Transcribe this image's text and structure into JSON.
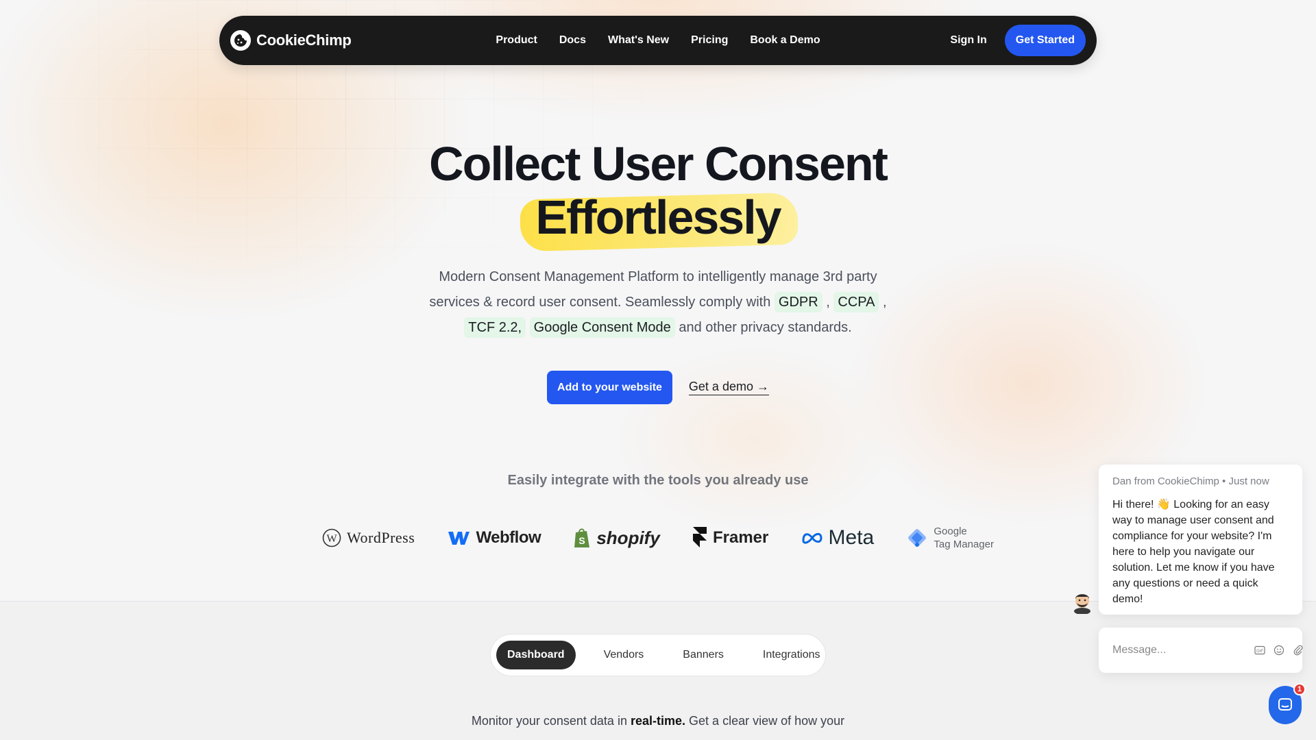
{
  "brand": {
    "name": "CookieChimp"
  },
  "nav": {
    "links": [
      "Product",
      "Docs",
      "What's New",
      "Pricing",
      "Book a Demo"
    ],
    "sign_in": "Sign In",
    "get_started": "Get Started"
  },
  "hero": {
    "title_line1": "Collect User Consent",
    "title_line2": "Effortlessly",
    "sub_part1": "Modern Consent Management Platform to intelligently manage 3rd party services & record user consent. Seamlessly comply with",
    "tag_gdpr": "GDPR",
    "sep1": ",",
    "tag_ccpa": "CCPA",
    "sep2": ",",
    "tag_tcf": "TCF 2.2,",
    "tag_gcm": "Google Consent Mode",
    "sub_part2": "and other privacy standards.",
    "cta_primary": "Add to your website",
    "cta_secondary": "Get a demo →"
  },
  "integrations": {
    "title": "Easily integrate with the tools you already use",
    "logos": {
      "wordpress": "WordPress",
      "webflow": "Webflow",
      "shopify": "shopify",
      "framer": "Framer",
      "meta": "Meta",
      "gtm_line1": "Google",
      "gtm_line2": "Tag Manager"
    }
  },
  "tabs": {
    "items": [
      "Dashboard",
      "Vendors",
      "Banners",
      "Integrations"
    ],
    "active": "Dashboard"
  },
  "monitor": {
    "part1": "Monitor your consent data in",
    "bold": "real-time.",
    "part2": "Get a clear view of how your"
  },
  "chat": {
    "meta": "Dan from CookieChimp • Just now",
    "message": "Hi there! 👋 Looking for an easy way to manage user consent and compliance for your website? I'm here to help you navigate our solution. Let me know if you have any questions or need a quick demo!",
    "input_placeholder": "Message...",
    "badge_count": "1"
  },
  "colors": {
    "accent_blue": "#2357f0",
    "nav_bg": "#1a1a1a",
    "highlight_yellow": "#fde047",
    "tag_green": "#e3f6e8"
  }
}
